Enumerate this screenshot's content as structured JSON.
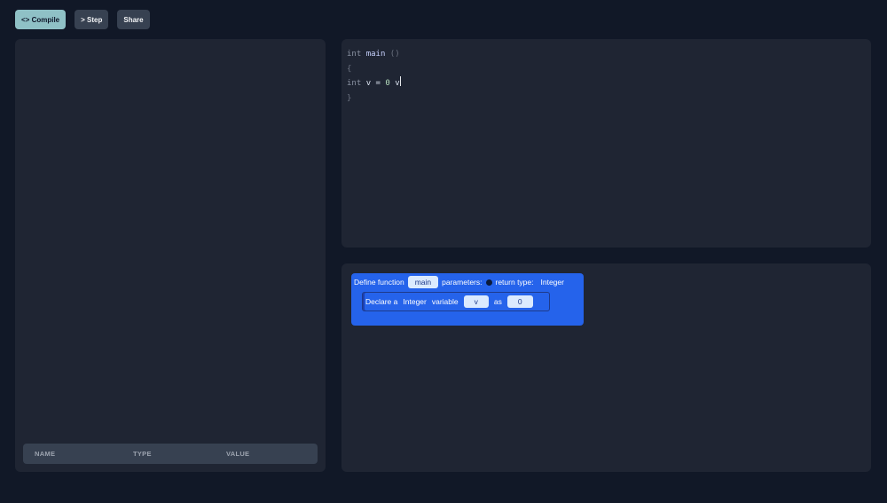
{
  "toolbar": {
    "compile_label": "<> Compile",
    "step_label": "> Step",
    "share_label": "Share"
  },
  "variables": {
    "columns": [
      "NAME",
      "TYPE",
      "VALUE"
    ]
  },
  "code": {
    "line1": {
      "kw": "int",
      "name": "main",
      "parens": "()"
    },
    "line2": "{",
    "line3": {
      "kw": "int",
      "id": "v",
      "op": "=",
      "num": "0",
      "tail": "v"
    },
    "line4": "}"
  },
  "blocks": {
    "function": {
      "define_label": "Define function",
      "name": "main",
      "parameters_label": "parameters:",
      "return_label": "return type:",
      "return_type": "Integer"
    },
    "declare": {
      "declare_label": "Declare a",
      "type": "Integer",
      "variable_label": "variable",
      "var_name": "v",
      "as_label": "as",
      "value": "0"
    }
  },
  "colors": {
    "background": "#111827",
    "panel": "#1f2533",
    "compile_button": "#8fc1c6",
    "block_blue": "#2563eb"
  }
}
